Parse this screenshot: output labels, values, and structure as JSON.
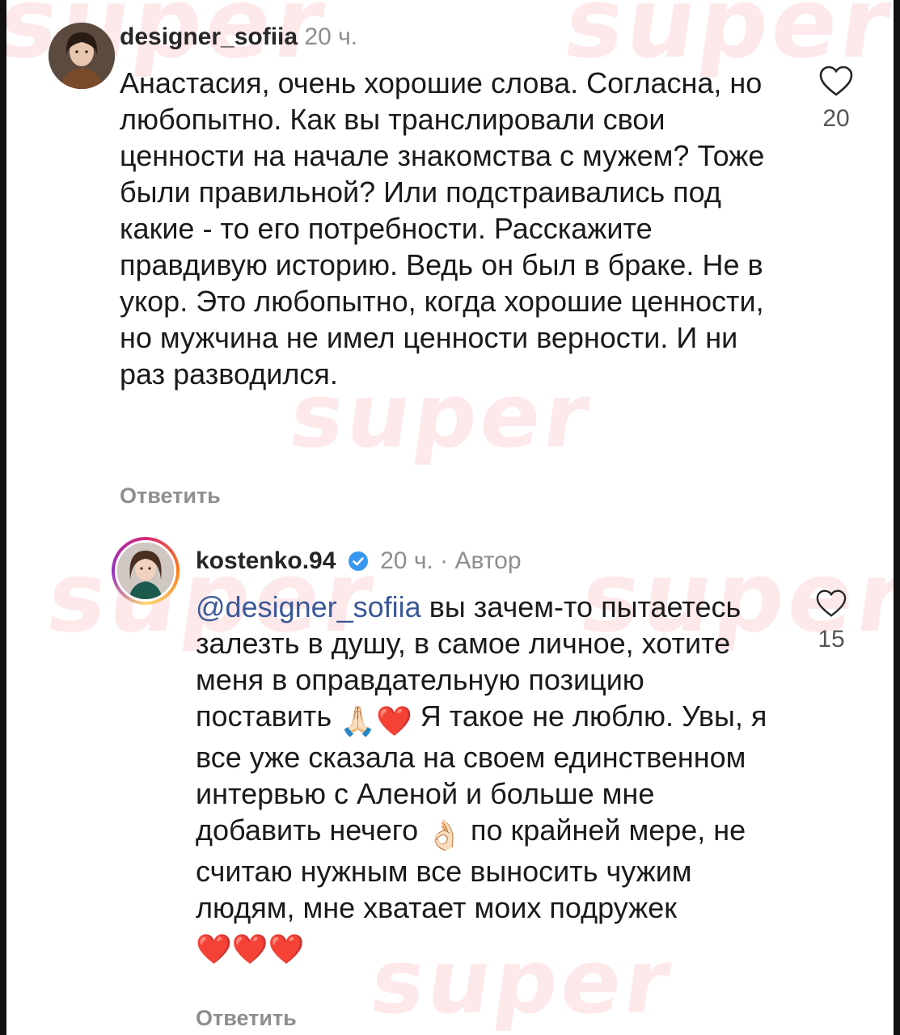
{
  "watermark": "super",
  "comments": [
    {
      "username": "designer_sofiia",
      "time": "20 ч.",
      "text": "Анастасия, очень хорошие слова. Согласна, но любопытно. Как вы транслировали свои ценности на начале знакомства с мужем? Тоже были правильной? Или подстраивались под какие - то его потребности. Расскажите правдивую историю. Ведь он был в браке. Не в укор. Это любопытно, когда хорошие ценности, но мужчина не имел ценности верности. И ни раз разводился.",
      "reply_label": "Ответить",
      "likes": "20",
      "icons": {
        "like": "heart-outline-icon",
        "avatar": "profile-photo"
      }
    },
    {
      "username": "kostenko.94",
      "time": "20 ч.",
      "separator": "·",
      "author_badge": "Автор",
      "mention": "@designer_sofiia",
      "text_1": "вы зачем-то пытаетесь залезть в душу, в самое личное, хотите меня в оправдательную позицию поставить",
      "text_2": "Я такое не люблю. Увы, я все уже сказала на своем единственном интервью с Аленой и больше мне добавить нечего",
      "text_3": "по крайней мере, не считаю нужным все выносить чужим людям, мне хватает моих подружек",
      "emoji_1": "🙏🏻❤️",
      "emoji_2": "👌🏻",
      "emoji_3": "❤️❤️❤️",
      "reply_label": "Ответить",
      "likes": "15",
      "icons": {
        "like": "heart-outline-icon",
        "verified": "verified-badge-icon",
        "avatar": "story-ring-avatar"
      }
    }
  ],
  "colors": {
    "mention": "#3b5998",
    "verified": "#3897f0",
    "muted": "#8e8e8e",
    "watermark": "#f596a0"
  }
}
